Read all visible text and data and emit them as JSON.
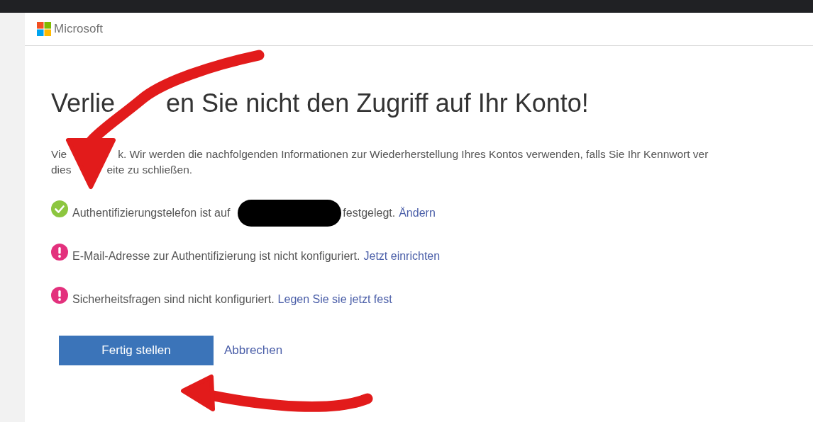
{
  "header": {
    "brand": "Microsoft"
  },
  "title": [
    "Verlie",
    "en Sie nicht den Zugriff auf Ihr Konto!"
  ],
  "intro_lines": [
    [
      "Vie",
      "k. Wir werden die nachfolgenden Informationen zur Wiederherstellung Ihres Kontos verwenden, falls Sie Ihr Kennwort ver"
    ],
    [
      "dies",
      "eite zu schließen."
    ]
  ],
  "items": [
    {
      "kind": "ok",
      "text": "Authentifizierungstelefon ist auf",
      "redacted": true,
      "text_after": "festgelegt.",
      "link": "Ändern"
    },
    {
      "kind": "missing",
      "text": "E-Mail-Adresse zur Authentifizierung ist nicht konfiguriert.",
      "redacted": false,
      "link": "Jetzt einrichten"
    },
    {
      "kind": "missing",
      "text": "Sicherheitsfragen sind nicht konfiguriert.",
      "redacted": false,
      "link": "Legen Sie sie jetzt fest"
    }
  ],
  "buttons": {
    "primary": "Fertig stellen",
    "secondary": "Abbrechen"
  }
}
